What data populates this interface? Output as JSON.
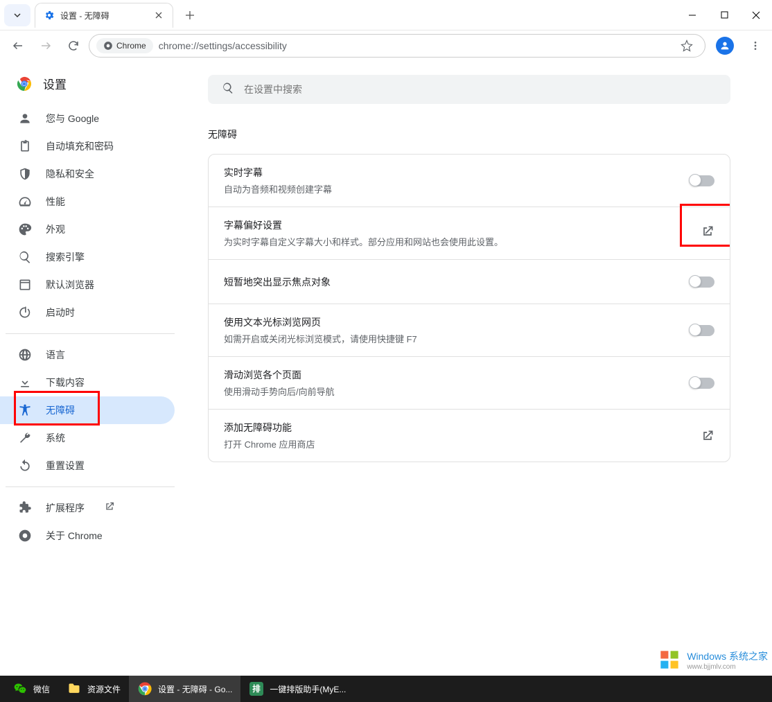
{
  "window": {
    "tab_title": "设置 - 无障碍"
  },
  "addressbar": {
    "chip_text": "Chrome",
    "url": "chrome://settings/accessibility"
  },
  "sidebar": {
    "title": "设置",
    "items": [
      {
        "label": "您与 Google"
      },
      {
        "label": "自动填充和密码"
      },
      {
        "label": "隐私和安全"
      },
      {
        "label": "性能"
      },
      {
        "label": "外观"
      },
      {
        "label": "搜索引擎"
      },
      {
        "label": "默认浏览器"
      },
      {
        "label": "启动时"
      }
    ],
    "items2": [
      {
        "label": "语言"
      },
      {
        "label": "下载内容"
      },
      {
        "label": "无障碍"
      },
      {
        "label": "系统"
      },
      {
        "label": "重置设置"
      }
    ],
    "items3": [
      {
        "label": "扩展程序"
      },
      {
        "label": "关于 Chrome"
      }
    ]
  },
  "main": {
    "search_placeholder": "在设置中搜索",
    "section_title": "无障碍",
    "rows": [
      {
        "title": "实时字幕",
        "desc": "自动为音频和视频创建字幕"
      },
      {
        "title": "字幕偏好设置",
        "desc": "为实时字幕自定义字幕大小和样式。部分应用和网站也会使用此设置。"
      },
      {
        "title": "短暂地突出显示焦点对象",
        "desc": ""
      },
      {
        "title": "使用文本光标浏览网页",
        "desc": "如需开启或关闭光标浏览模式，请使用快捷键 F7"
      },
      {
        "title": "滑动浏览各个页面",
        "desc": "使用滑动手势向后/向前导航"
      },
      {
        "title": "添加无障碍功能",
        "desc": "打开 Chrome 应用商店"
      }
    ]
  },
  "taskbar": {
    "items": [
      {
        "label": "微信"
      },
      {
        "label": "资源文件"
      },
      {
        "label": "设置 - 无障碍 - Go..."
      },
      {
        "label": "一键排版助手(MyE..."
      }
    ]
  },
  "watermark": {
    "main": "Windows 系统之家",
    "sub": "www.bjjmlv.com"
  }
}
